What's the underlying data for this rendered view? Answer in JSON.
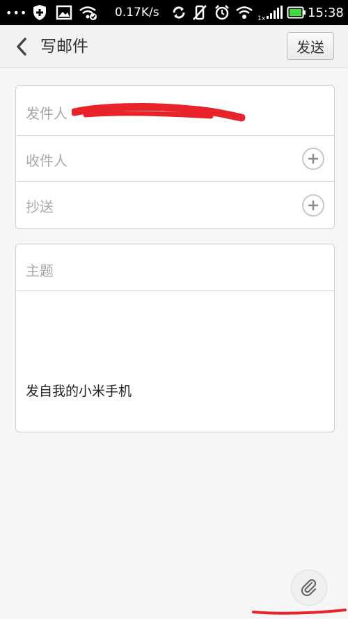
{
  "status_bar": {
    "dots": "•••",
    "speed": "0.17K/s",
    "sim_label": "1x",
    "time": "15:38",
    "icons": [
      "shield-icon",
      "image-icon",
      "wifi-check-icon",
      "sync-icon",
      "vibrate-off-icon",
      "alarm-icon",
      "wifi-icon",
      "signal-icon",
      "battery-icon"
    ]
  },
  "header": {
    "back_icon": "chevron-left-icon",
    "title": "写邮件",
    "send_label": "发送"
  },
  "compose": {
    "from_label": "发件人",
    "to_label": "收件人",
    "cc_label": "抄送",
    "subject_placeholder": "主题",
    "signature": "发自我的小米手机"
  },
  "attachment_button": {
    "icon": "paperclip-icon"
  },
  "colors": {
    "status_bar_bg": "#000000",
    "redaction": "#e8232a",
    "page_bg": "#f6f6f6"
  }
}
